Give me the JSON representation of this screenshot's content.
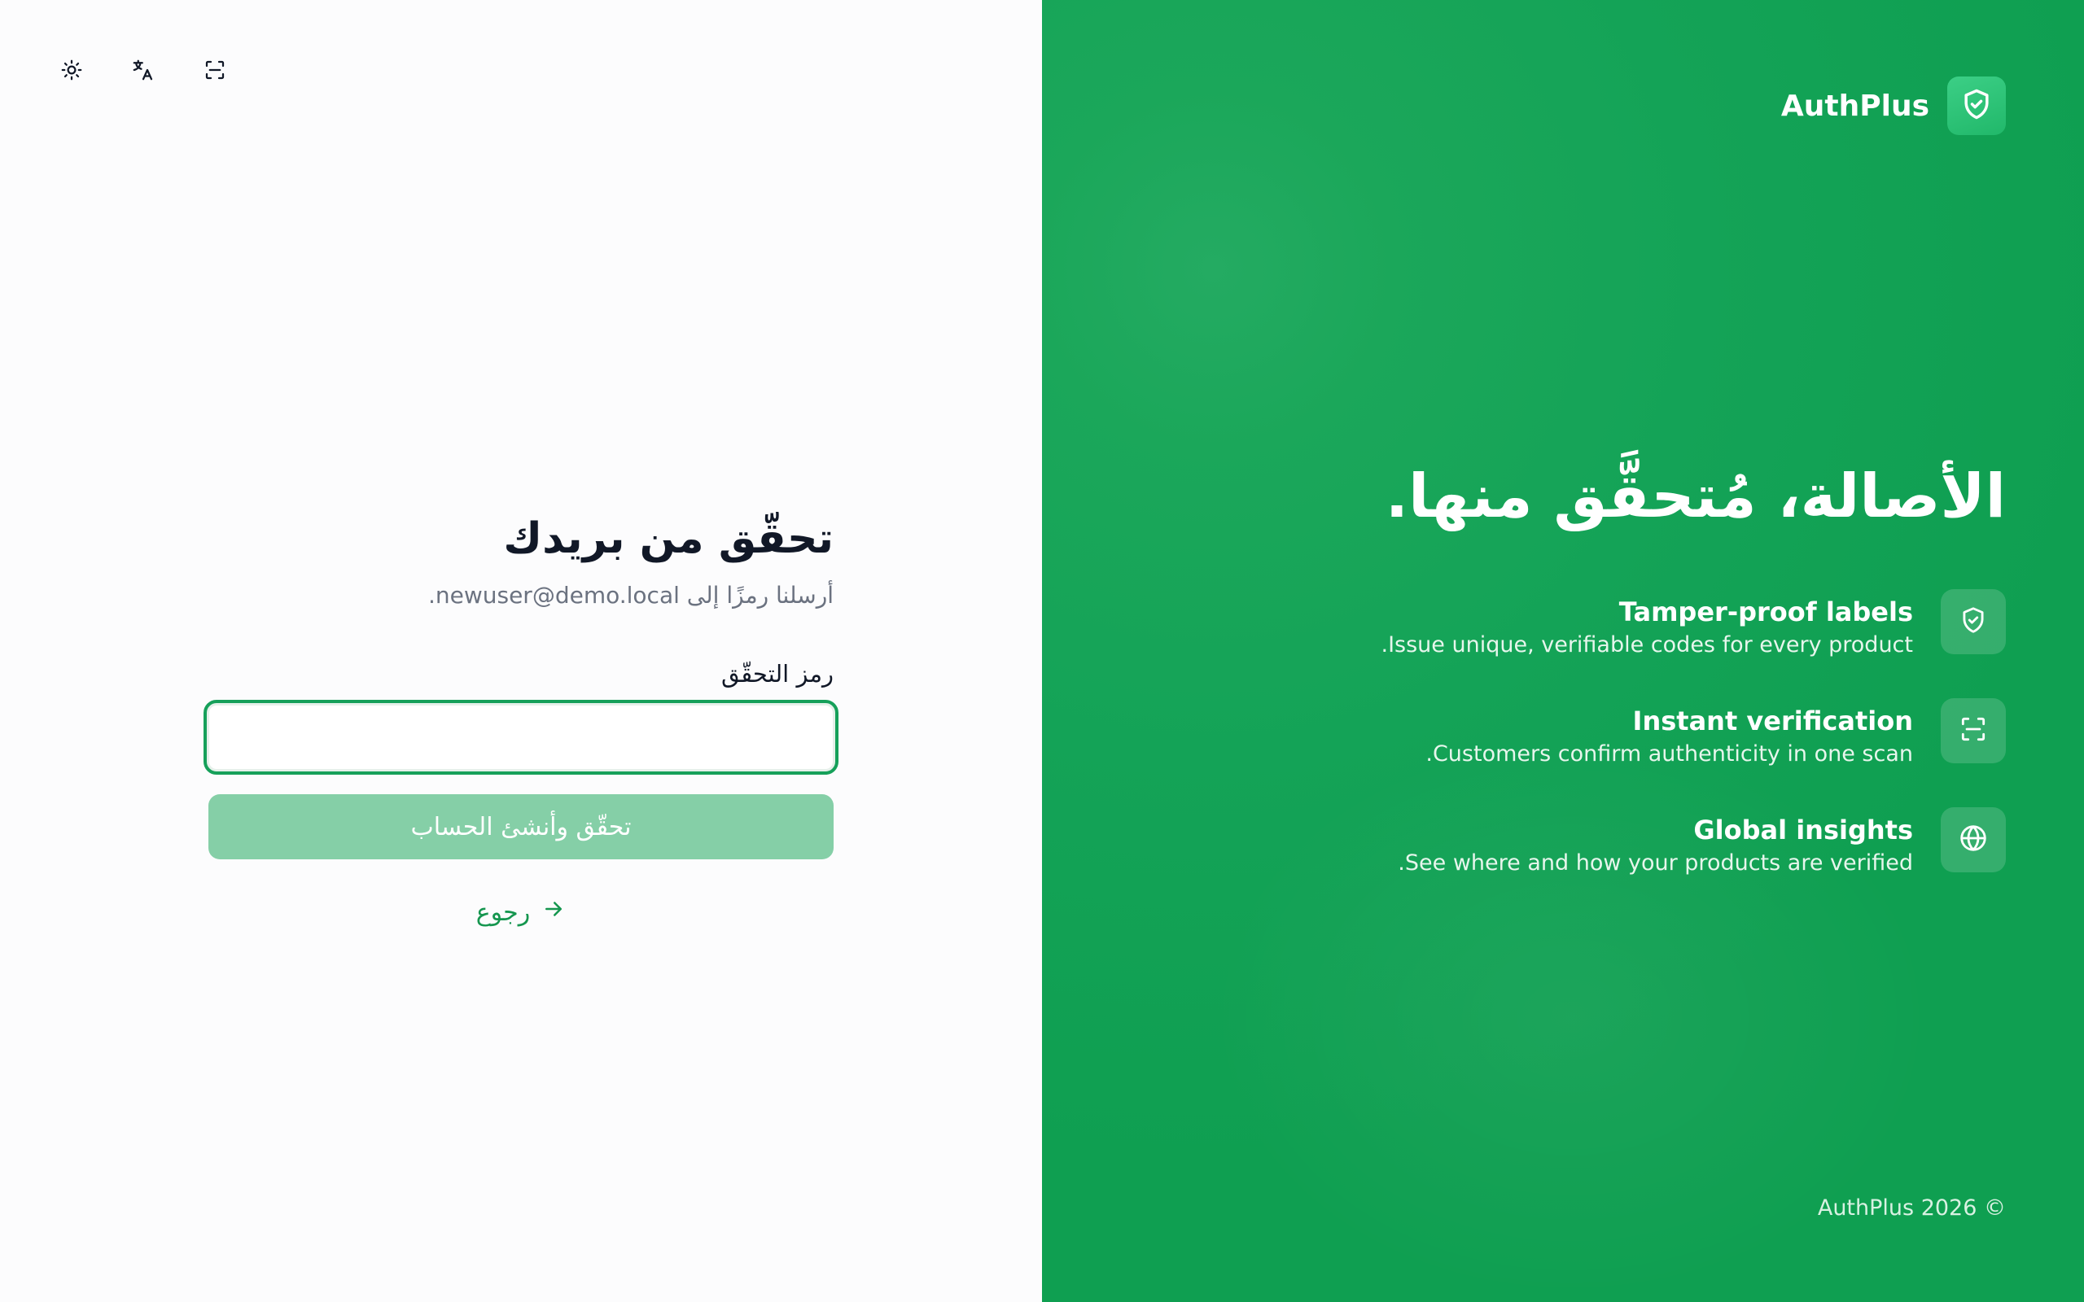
{
  "toolbar": {
    "theme_icon": "sun-icon",
    "language_icon": "translate-icon",
    "scan_icon": "scan-icon"
  },
  "form": {
    "title": "تحقّق من بريدك",
    "subtitle": "أرسلنا رمزًا إلى newuser@demo.local.",
    "code_label": "رمز التحقّق",
    "code_value": "",
    "code_placeholder": "",
    "submit_label": "تحقّق وأنشئ الحساب",
    "back_label": "رجوع"
  },
  "brand": {
    "name": "AuthPlus",
    "logo_icon": "shield-check-icon",
    "hero_title": "الأصالة، مُتحقَّق منها.",
    "features": [
      {
        "icon": "shield-check-icon",
        "title": "Tamper-proof labels",
        "description": "Issue unique, verifiable codes for every product."
      },
      {
        "icon": "scan-icon",
        "title": "Instant verification",
        "description": "Customers confirm authenticity in one scan."
      },
      {
        "icon": "globe-icon",
        "title": "Global insights",
        "description": "See where and how your products are verified."
      }
    ],
    "footer": "© 2026 AuthPlus"
  },
  "colors": {
    "accent": "#16a05a",
    "button_disabled": "#85cfa7",
    "panel_green": "#14a357"
  }
}
